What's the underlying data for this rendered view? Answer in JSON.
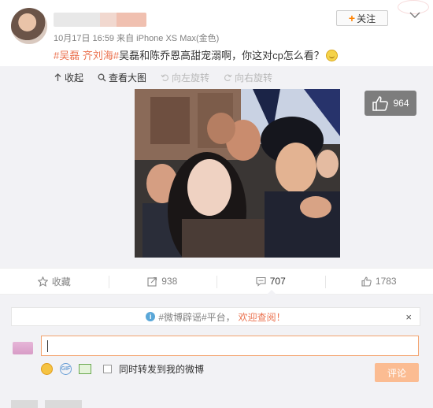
{
  "header": {
    "meta": "10月17日 16:59 来自 iPhone XS Max(金色)",
    "follow_label": "关注"
  },
  "post": {
    "tag1": "#吴磊 齐刘海#",
    "text": "吴磊和陈乔恩高甜宠溺啊，你这对cp怎么看？"
  },
  "media_toolbar": {
    "collapse": "收起",
    "view_large": "查看大图",
    "rotate_left": "向左旋转",
    "rotate_right": "向右旋转"
  },
  "photo": {
    "like_count": "964"
  },
  "actions": {
    "favorite": "收藏",
    "repost": "938",
    "comment": "707",
    "like": "1783"
  },
  "comment": {
    "notice_tag": "#微博辟谣#平台，",
    "notice_link": "欢迎查阅！",
    "close": "×",
    "forward_label": "同时转发到我的微博",
    "submit_label": "评论"
  },
  "colors": {
    "accent": "#eb7350",
    "follow_plus": "#ff8200",
    "submit_bg": "#fbbc92",
    "input_border": "#f3a36e"
  }
}
